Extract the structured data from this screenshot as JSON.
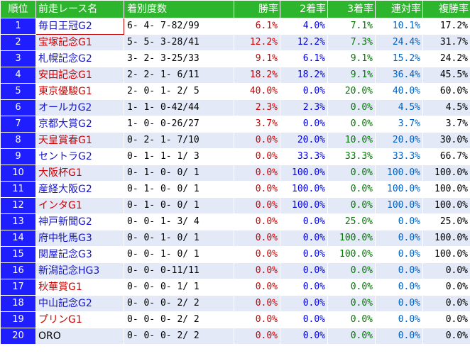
{
  "header": {
    "rank": "順位",
    "race": "前走レース名",
    "record": "着別度数",
    "win": "勝率",
    "second": "2着率",
    "third": "3着率",
    "quinella": "連対率",
    "place": "複勝率"
  },
  "rows": [
    {
      "rank": "1",
      "race": "毎日王冠G2",
      "grade": "g2",
      "record": "6- 4- 7-82/99",
      "win": "6.1%",
      "second": "4.0%",
      "third": "7.1%",
      "quinella": "10.1%",
      "place": "17.2%"
    },
    {
      "rank": "2",
      "race": "宝塚記念G1",
      "grade": "g1",
      "record": "5- 5- 3-28/41",
      "win": "12.2%",
      "second": "12.2%",
      "third": "7.3%",
      "quinella": "24.4%",
      "place": "31.7%"
    },
    {
      "rank": "3",
      "race": "札幌記念G2",
      "grade": "g2",
      "record": "3- 2- 3-25/33",
      "win": "9.1%",
      "second": "6.1%",
      "third": "9.1%",
      "quinella": "15.2%",
      "place": "24.2%"
    },
    {
      "rank": "4",
      "race": "安田記念G1",
      "grade": "g1",
      "record": "2- 2- 1- 6/11",
      "win": "18.2%",
      "second": "18.2%",
      "third": "9.1%",
      "quinella": "36.4%",
      "place": "45.5%"
    },
    {
      "rank": "5",
      "race": "東京優駿G1",
      "grade": "g1",
      "record": "2- 0- 1- 2/ 5",
      "win": "40.0%",
      "second": "0.0%",
      "third": "20.0%",
      "quinella": "40.0%",
      "place": "60.0%"
    },
    {
      "rank": "6",
      "race": "オールカG2",
      "grade": "g2",
      "record": "1- 1- 0-42/44",
      "win": "2.3%",
      "second": "2.3%",
      "third": "0.0%",
      "quinella": "4.5%",
      "place": "4.5%"
    },
    {
      "rank": "7",
      "race": "京都大賞G2",
      "grade": "g2",
      "record": "1- 0- 0-26/27",
      "win": "3.7%",
      "second": "0.0%",
      "third": "0.0%",
      "quinella": "3.7%",
      "place": "3.7%"
    },
    {
      "rank": "8",
      "race": "天皇賞春G1",
      "grade": "g1",
      "record": "0- 2- 1- 7/10",
      "win": "0.0%",
      "second": "20.0%",
      "third": "10.0%",
      "quinella": "20.0%",
      "place": "30.0%"
    },
    {
      "rank": "9",
      "race": "セントラG2",
      "grade": "g2",
      "record": "0- 1- 1- 1/ 3",
      "win": "0.0%",
      "second": "33.3%",
      "third": "33.3%",
      "quinella": "33.3%",
      "place": "66.7%"
    },
    {
      "rank": "10",
      "race": "大阪杯G1",
      "grade": "g1",
      "record": "0- 1- 0- 0/ 1",
      "win": "0.0%",
      "second": "100.0%",
      "third": "0.0%",
      "quinella": "100.0%",
      "place": "100.0%"
    },
    {
      "rank": "11",
      "race": "産経大阪G2",
      "grade": "g2",
      "record": "0- 1- 0- 0/ 1",
      "win": "0.0%",
      "second": "100.0%",
      "third": "0.0%",
      "quinella": "100.0%",
      "place": "100.0%"
    },
    {
      "rank": "12",
      "race": "インタG1",
      "grade": "g1",
      "record": "0- 1- 0- 0/ 1",
      "win": "0.0%",
      "second": "100.0%",
      "third": "0.0%",
      "quinella": "100.0%",
      "place": "100.0%"
    },
    {
      "rank": "13",
      "race": "神戸新聞G2",
      "grade": "g2",
      "record": "0- 0- 1- 3/ 4",
      "win": "0.0%",
      "second": "0.0%",
      "third": "25.0%",
      "quinella": "0.0%",
      "place": "25.0%"
    },
    {
      "rank": "14",
      "race": "府中牝馬G3",
      "grade": "g3",
      "record": "0- 0- 1- 0/ 1",
      "win": "0.0%",
      "second": "0.0%",
      "third": "100.0%",
      "quinella": "0.0%",
      "place": "100.0%"
    },
    {
      "rank": "15",
      "race": "関屋記念G3",
      "grade": "g3",
      "record": "0- 0- 1- 0/ 1",
      "win": "0.0%",
      "second": "0.0%",
      "third": "100.0%",
      "quinella": "0.0%",
      "place": "100.0%"
    },
    {
      "rank": "16",
      "race": "新潟記念HG3",
      "grade": "g3",
      "record": "0- 0- 0-11/11",
      "win": "0.0%",
      "second": "0.0%",
      "third": "0.0%",
      "quinella": "0.0%",
      "place": "0.0%"
    },
    {
      "rank": "17",
      "race": "秋華賞G1",
      "grade": "g1",
      "record": "0- 0- 0- 1/ 1",
      "win": "0.0%",
      "second": "0.0%",
      "third": "0.0%",
      "quinella": "0.0%",
      "place": "0.0%"
    },
    {
      "rank": "18",
      "race": "中山記念G2",
      "grade": "g2",
      "record": "0- 0- 0- 2/ 2",
      "win": "0.0%",
      "second": "0.0%",
      "third": "0.0%",
      "quinella": "0.0%",
      "place": "0.0%"
    },
    {
      "rank": "19",
      "race": "プリンG1",
      "grade": "g1",
      "record": "0- 0- 0- 2/ 2",
      "win": "0.0%",
      "second": "0.0%",
      "third": "0.0%",
      "quinella": "0.0%",
      "place": "0.0%"
    },
    {
      "rank": "20",
      "race": "ORO",
      "grade": "none",
      "record": "0- 0- 0- 2/ 2",
      "win": "0.0%",
      "second": "0.0%",
      "third": "0.0%",
      "quinella": "0.0%",
      "place": "0.0%"
    }
  ],
  "colors": {
    "header_bg": "#2db52d",
    "rank_bg": "#1e1eff",
    "alt_row_bg": "#e3e9f7",
    "win_color": "#d00000",
    "second_color": "#0000e0",
    "third_color": "#007a00",
    "quinella_color": "#0060c0",
    "place_color": "#000000"
  }
}
